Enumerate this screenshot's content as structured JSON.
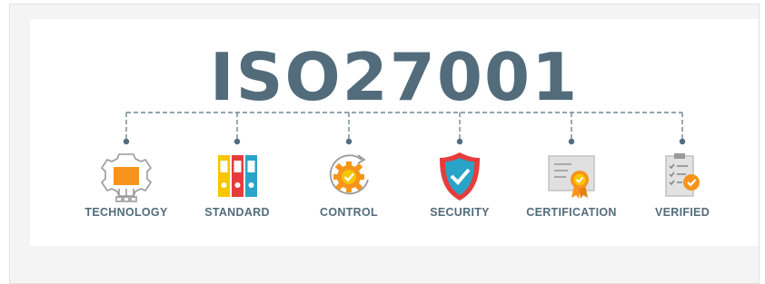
{
  "title": "ISO27001",
  "items": [
    {
      "label": "TECHNOLOGY",
      "icon": "chip-gear-icon"
    },
    {
      "label": "STANDARD",
      "icon": "binders-icon"
    },
    {
      "label": "CONTROL",
      "icon": "gear-check-icon"
    },
    {
      "label": "SECURITY",
      "icon": "shield-check-icon"
    },
    {
      "label": "CERTIFICATION",
      "icon": "certificate-icon"
    },
    {
      "label": "VERIFIED",
      "icon": "checklist-icon"
    }
  ],
  "colors": {
    "primary": "#526c7b",
    "orange": "#f7941d",
    "yellow": "#f7c600",
    "red": "#e63d3c",
    "blue": "#2aa3c9",
    "grey": "#bdbdbd"
  }
}
